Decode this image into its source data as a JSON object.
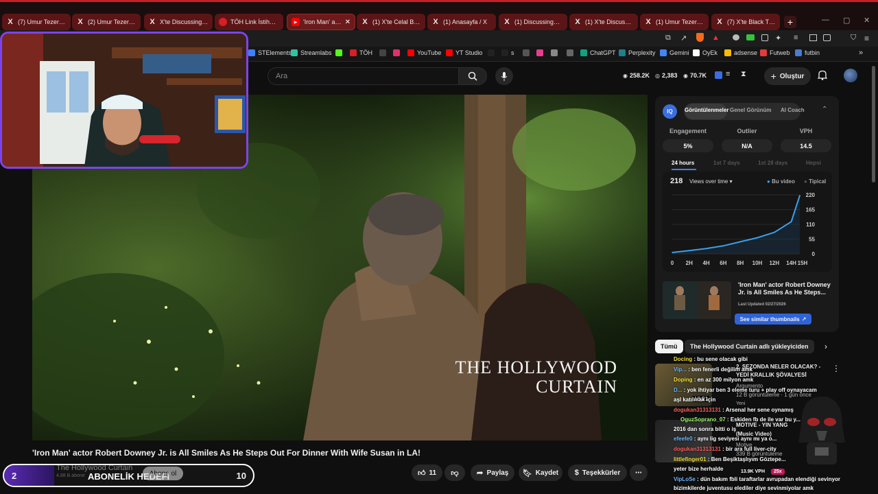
{
  "browser": {
    "tabs": [
      {
        "icon": "x-logo-icon",
        "label": "(7) Umur Tezer (@U"
      },
      {
        "icon": "x-logo-icon",
        "label": "(2) Umur Tezer (@U"
      },
      {
        "icon": "x-logo-icon",
        "label": "X'te DiscussingFilm"
      },
      {
        "icon": "toh-logo-icon",
        "label": "TÖH Link İstihbarat"
      },
      {
        "icon": "youtube-icon",
        "label": "'Iron Man' actor",
        "active": true
      },
      {
        "icon": "x-logo-icon",
        "label": "(1) X'te Celal Bayç"
      },
      {
        "icon": "x-logo-icon",
        "label": "(1) Anasayfa / X"
      },
      {
        "icon": "x-logo-icon",
        "label": "(1) DiscussingFilm"
      },
      {
        "icon": "x-logo-icon",
        "label": "(1) X'te Discussing"
      },
      {
        "icon": "x-logo-icon",
        "label": "(1) Umur Tezer (@U"
      },
      {
        "icon": "x-logo-icon",
        "label": "(7) X'te Black Thund"
      }
    ],
    "bookmarks": [
      {
        "label": "STElements",
        "color": "#3b82f6"
      },
      {
        "label": "Streamlabs",
        "color": "#31c3a2"
      },
      {
        "label": "",
        "color": "#53fc18"
      },
      {
        "label": "TÖH",
        "color": "#d61f26"
      },
      {
        "label": "",
        "color": "#444444"
      },
      {
        "label": "",
        "color": "#e1306c"
      },
      {
        "label": "YouTube",
        "color": "#ff0000"
      },
      {
        "label": "YT Studio",
        "color": "#ff0000"
      },
      {
        "label": "",
        "color": "#222222"
      },
      {
        "label": "s",
        "color": "#222222"
      },
      {
        "label": "",
        "color": "#555555"
      },
      {
        "label": "",
        "color": "#e83e8c"
      },
      {
        "label": "",
        "color": "#888888"
      },
      {
        "label": "",
        "color": "#666666"
      },
      {
        "label": "ChatGPT",
        "color": "#10a37f"
      },
      {
        "label": "Perplexity",
        "color": "#20808d"
      },
      {
        "label": "Gemini",
        "color": "#4285f4"
      },
      {
        "label": "OyEk",
        "color": "#ffffff"
      },
      {
        "label": "adsense",
        "color": "#fbbc04"
      },
      {
        "label": "Futweb",
        "color": "#e23b3b"
      },
      {
        "label": "futbin",
        "color": "#4a7bd0"
      }
    ]
  },
  "youtube": {
    "search_placeholder": "Ara",
    "stats": [
      "258.2K",
      "2,383",
      "70.7K"
    ],
    "create_label": "Oluştur",
    "video_title": "'Iron Man' actor Robert Downey Jr. is All Smiles As He Steps Out For Dinner With Wife Susan in LA!",
    "video_watermark": [
      "THE HOLLYWOOD",
      "CURTAIN"
    ],
    "channel_name": "The Hollywood Curtain",
    "channel_subs": "4,88 B abone",
    "subscribe_label": "Abone ol",
    "like_count": "11",
    "share_label": "Paylaş",
    "save_label": "Kaydet",
    "thanks_label": "Teşekkürler"
  },
  "overlay": {
    "goal_label": "ABONELİK HEDEFİ",
    "goal_current": "2",
    "goal_target": "10",
    "goal_progress": 0.2
  },
  "vidiq": {
    "tabs": [
      "Görüntülenmeler",
      "Genel Görünüm",
      "AI Coach"
    ],
    "metrics": [
      {
        "label": "Engagement",
        "value": "5%"
      },
      {
        "label": "Outlier",
        "value": "N/A"
      },
      {
        "label": "VPH",
        "value": "14.5"
      }
    ],
    "periods": [
      "24 hours",
      "1st 7 days",
      "1st 28 days",
      "Hepsi"
    ],
    "views": "218",
    "views_dropdown": "Views over time",
    "legend": [
      "Bu video",
      "Tipical"
    ],
    "suggestion_title": "'Iron Man' actor Robert Downey Jr. is All Smiles As He Steps...",
    "suggestion_updated": "Last Updated 02/27/2026",
    "suggestion_button": "See similar thumbnails"
  },
  "chart_data": {
    "type": "line",
    "title": "",
    "x": [
      "0",
      "2H",
      "4H",
      "6H",
      "8H",
      "10H",
      "12H",
      "14H",
      "15H"
    ],
    "y_ticks": [
      0,
      55,
      110,
      165,
      220
    ],
    "ylim": [
      0,
      220
    ],
    "series": [
      {
        "name": "Bu video",
        "values": [
          5,
          12,
          20,
          30,
          45,
          60,
          80,
          120,
          218
        ]
      }
    ]
  },
  "related": {
    "chips": [
      "Tümü",
      "The Hollywood Curtain adlı yükleyiciden"
    ],
    "ghost_items": [
      "2. SEZONDA NELER OLACAK? -",
      "YEDİ KRALLIK ŞÖVALYESİ",
      "Argumento",
      "12 B görüntüleme · 1 gün önce",
      "Yeni",
      "MOTIVE - YIN YANG",
      "(Music Video)",
      "Motive",
      "339 B görüntüleme",
      "18:31",
      "13.9K VPH",
      "25x"
    ]
  },
  "chat": [
    {
      "user": "Docing",
      "text": "bu sene olacak gibi",
      "color": "u"
    },
    {
      "user": "Vip...",
      "text": "ben fenerli değilim amk",
      "color": "u2"
    },
    {
      "user": "Doping",
      "text": "en az 300 milyon amk",
      "color": "u"
    },
    {
      "user": "D...",
      "text": "yok ihtiyar ben 3 eleme turu + play off oynayacam",
      "color": "u2"
    },
    {
      "user": "",
      "text": "aşl katılmak için",
      "color": "u"
    },
    {
      "user": "dogukan31313131",
      "text": "Arsenal her sene oynamış",
      "color": "u3"
    },
    {
      "user": "OguzSoprano_07",
      "text": "Eskiden fb de ile var bu y...",
      "color": "u4"
    },
    {
      "user": "",
      "text": "2016 dan sonra bitti o iş",
      "color": "u"
    },
    {
      "user": "efeefe0",
      "text": "aynı lig seviyesi aynı mı ya o...",
      "color": "u2"
    },
    {
      "user": "dogukan31313131",
      "text": "bir ara full liver-city",
      "color": "u3"
    },
    {
      "user": "littlefinger01",
      "text": "Ben Beşiktaşlıyım Göztepe...",
      "color": "u"
    },
    {
      "user": "",
      "text": "yeter bize herhalde",
      "color": "u"
    },
    {
      "user": "VipLoSe",
      "text": "dün bakım fbli taraftarlar avrupadan elendiği sevinyor",
      "color": "u2"
    },
    {
      "user": "",
      "text": "bizimkilerde juventusu elediler diye sevinmiyolar amk",
      "color": "u"
    }
  ]
}
